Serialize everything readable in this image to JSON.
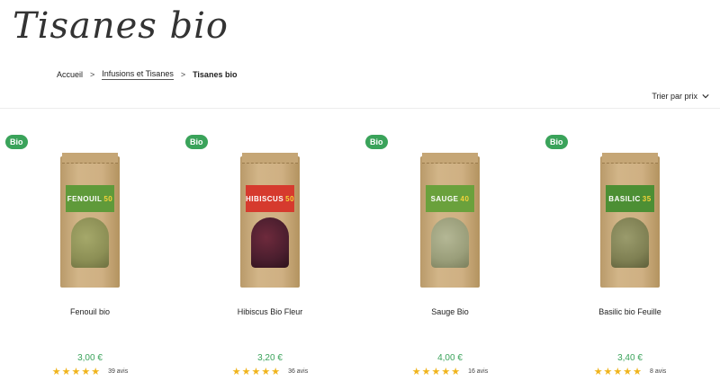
{
  "page": {
    "title": "Tisanes bio"
  },
  "breadcrumb": {
    "home": "Accueil",
    "sep": ">",
    "parent": "Infusions et Tisanes",
    "current": "Tisanes bio"
  },
  "sort": {
    "label": "Trier par prix",
    "icon": "chevron-down-icon"
  },
  "products": [
    {
      "badge": "Bio",
      "name": "Fenouil bio",
      "price": "3,00 €",
      "stars": "★★★★★",
      "reviews": "39 avis",
      "pack_label": "FENOUIL",
      "pack_num": "50",
      "colors": {
        "label": "#5f9a3a",
        "window": "#8c8f55"
      }
    },
    {
      "badge": "Bio",
      "name": "Hibiscus Bio Fleur",
      "price": "3,20 €",
      "stars": "★★★★★",
      "reviews": "36 avis",
      "pack_label": "HIBISCUS",
      "pack_num": "50",
      "colors": {
        "label": "#d63a2e",
        "window": "#4a1e2e"
      }
    },
    {
      "badge": "Bio",
      "name": "Sauge Bio",
      "price": "4,00 €",
      "stars": "★★★★★",
      "reviews": "16 avis",
      "pack_label": "SAUGE",
      "pack_num": "40",
      "colors": {
        "label": "#6aa13c",
        "window": "#9a9e7a"
      }
    },
    {
      "badge": "Bio",
      "name": "Basilic bio Feuille",
      "price": "3,40 €",
      "stars": "★★★★★",
      "reviews": "8 avis",
      "pack_label": "BASILIC",
      "pack_num": "35",
      "colors": {
        "label": "#4c8f34",
        "window": "#7f8053"
      }
    }
  ]
}
